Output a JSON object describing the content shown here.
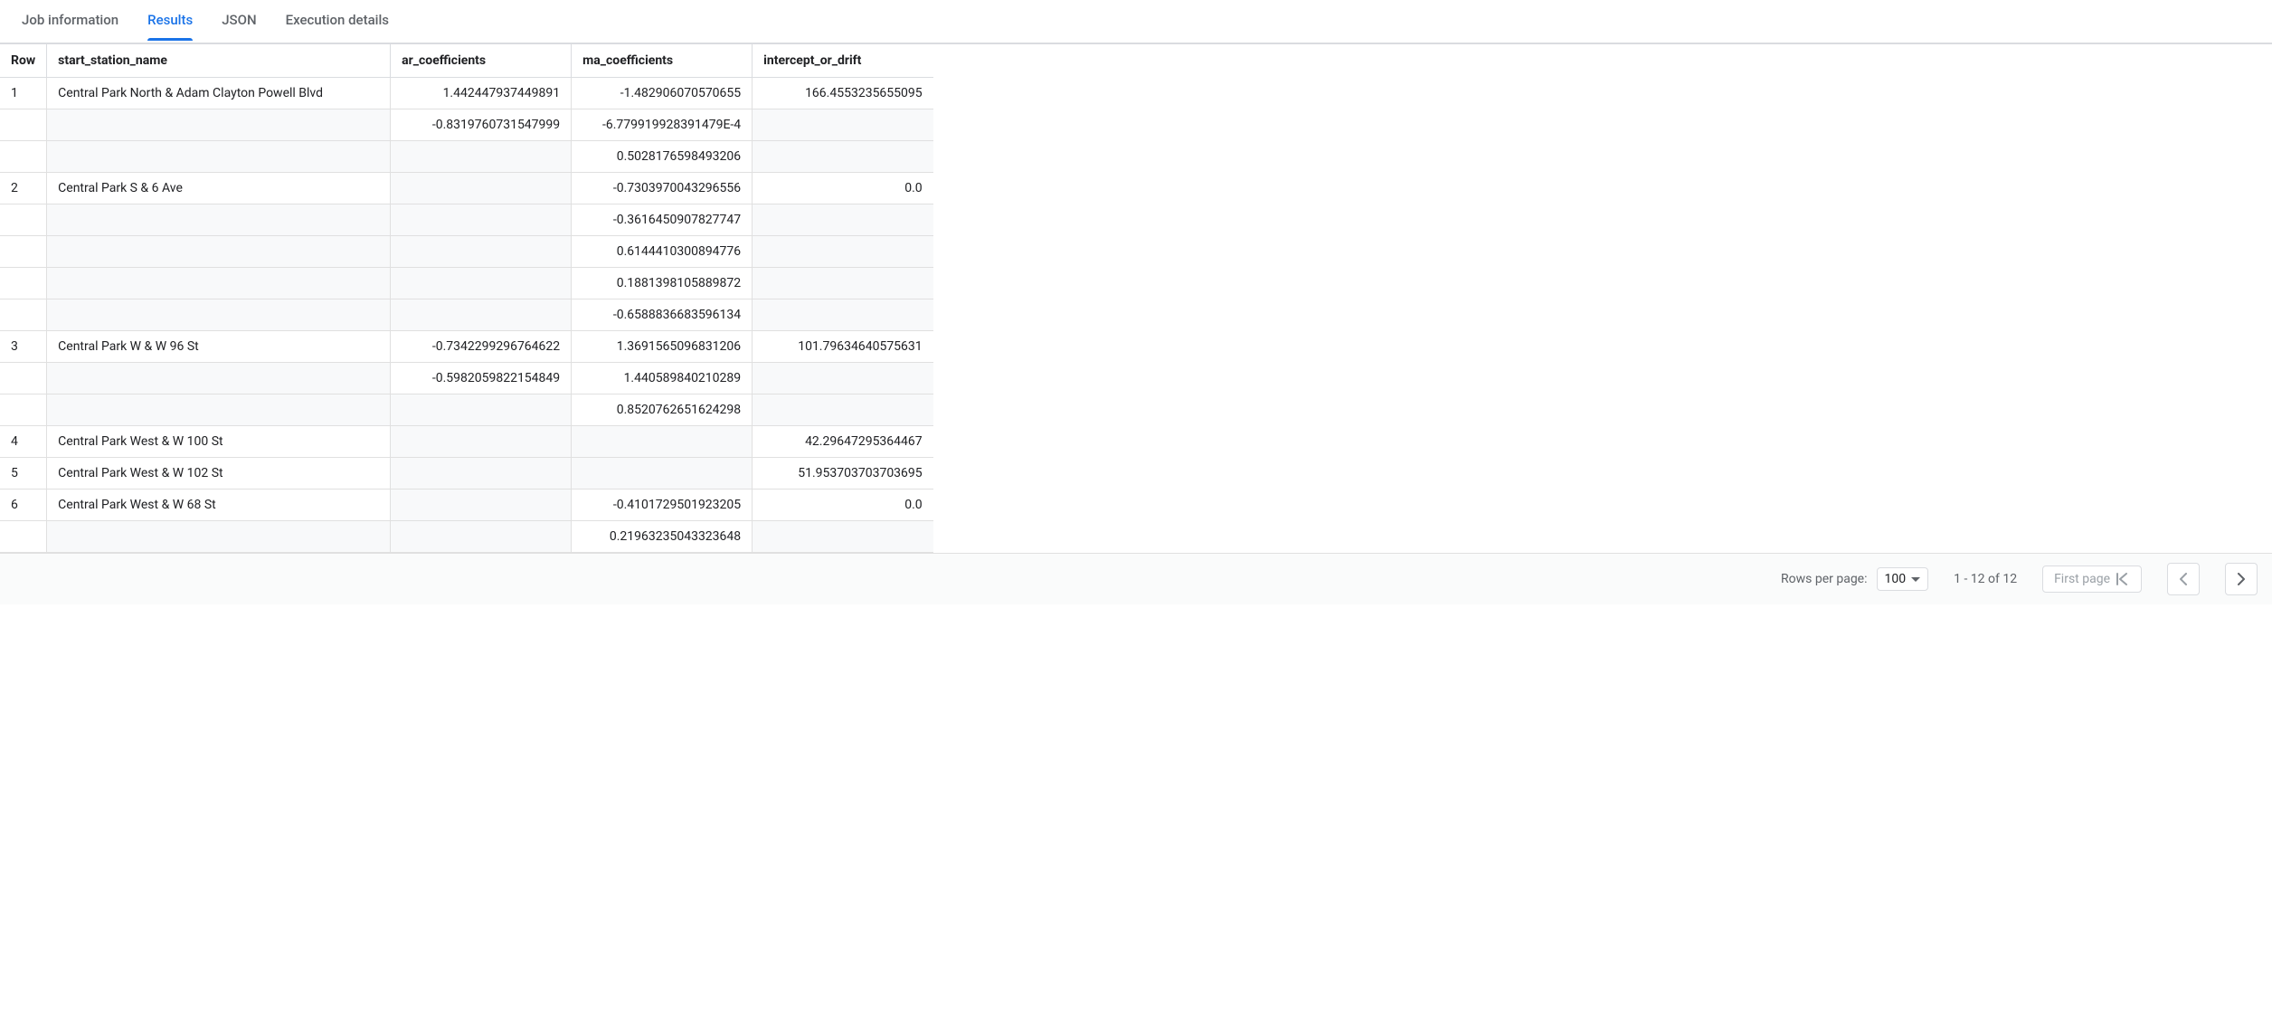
{
  "tabs": [
    {
      "label": "Job information",
      "active": false
    },
    {
      "label": "Results",
      "active": true
    },
    {
      "label": "JSON",
      "active": false
    },
    {
      "label": "Execution details",
      "active": false
    }
  ],
  "columns": {
    "row": "Row",
    "start_station_name": "start_station_name",
    "ar_coefficients": "ar_coefficients",
    "ma_coefficients": "ma_coefficients",
    "intercept_or_drift": "intercept_or_drift"
  },
  "rows": [
    {
      "row": "1",
      "start_station_name": "Central Park North & Adam Clayton Powell Blvd",
      "ar_coefficients": [
        "1.442447937449891",
        "-0.8319760731547999",
        ""
      ],
      "ma_coefficients": [
        "-1.482906070570655",
        "-6.779919928391479E-4",
        "0.5028176598493206"
      ],
      "intercept_or_drift": "166.4553235655095"
    },
    {
      "row": "2",
      "start_station_name": "Central Park S & 6 Ave",
      "ar_coefficients": [
        "",
        "",
        "",
        "",
        ""
      ],
      "ma_coefficients": [
        "-0.7303970043296556",
        "-0.3616450907827747",
        "0.6144410300894776",
        "0.1881398105889872",
        "-0.6588836683596134"
      ],
      "intercept_or_drift": "0.0"
    },
    {
      "row": "3",
      "start_station_name": "Central Park W & W 96 St",
      "ar_coefficients": [
        "-0.7342299296764622",
        "-0.5982059822154849",
        ""
      ],
      "ma_coefficients": [
        "1.3691565096831206",
        "1.440589840210289",
        "0.8520762651624298"
      ],
      "intercept_or_drift": "101.79634640575631"
    },
    {
      "row": "4",
      "start_station_name": "Central Park West & W 100 St",
      "ar_coefficients": [
        ""
      ],
      "ma_coefficients": [
        ""
      ],
      "intercept_or_drift": "42.29647295364467"
    },
    {
      "row": "5",
      "start_station_name": "Central Park West & W 102 St",
      "ar_coefficients": [
        ""
      ],
      "ma_coefficients": [
        ""
      ],
      "intercept_or_drift": "51.953703703703695"
    },
    {
      "row": "6",
      "start_station_name": "Central Park West & W 68 St",
      "ar_coefficients": [
        "",
        ""
      ],
      "ma_coefficients": [
        "-0.4101729501923205",
        "0.21963235043323648"
      ],
      "intercept_or_drift": "0.0"
    }
  ],
  "footer": {
    "rows_per_page_label": "Rows per page:",
    "rows_per_page_value": "100",
    "range_text": "1 - 12 of 12",
    "first_page_label": "First page"
  }
}
